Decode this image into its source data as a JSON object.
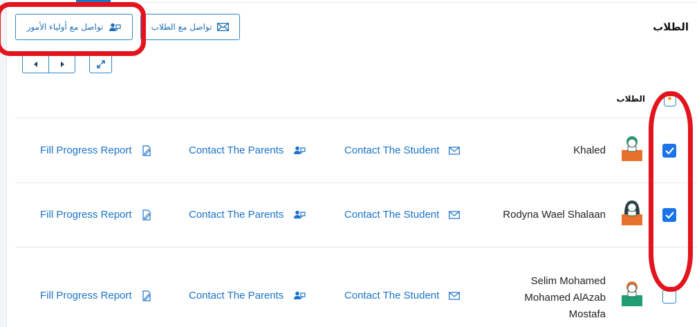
{
  "header": {
    "title": "الطلاب",
    "contact_parents_btn": "تواصل مع أولياء الأمور",
    "contact_students_btn": "تواصل مع الطلاب"
  },
  "table": {
    "column_header": "الطلاب",
    "rows": [
      {
        "name": "Khaled",
        "checked": true,
        "avatar": "boy-avatar",
        "fill_report": "Fill Progress Report",
        "contact_parents": "Contact The Parents",
        "contact_student": "Contact The Student"
      },
      {
        "name": "Rodyna Wael Shalaan",
        "checked": true,
        "avatar": "girl-avatar",
        "fill_report": "Fill Progress Report",
        "contact_parents": "Contact The Parents",
        "contact_student": "Contact The Student"
      },
      {
        "name_lines": [
          "Selim Mohamed",
          "Mohamed AlAzab",
          "Mostafa"
        ],
        "checked": false,
        "avatar": "boy-avatar",
        "fill_report": "Fill Progress Report",
        "contact_parents": "Contact The Parents",
        "contact_student": "Contact The Student"
      }
    ]
  },
  "colors": {
    "accent": "#1a73c9",
    "annotation": "#e3141d",
    "avatar_body": "#e8722b",
    "avatar_head": "#1f9e74"
  }
}
